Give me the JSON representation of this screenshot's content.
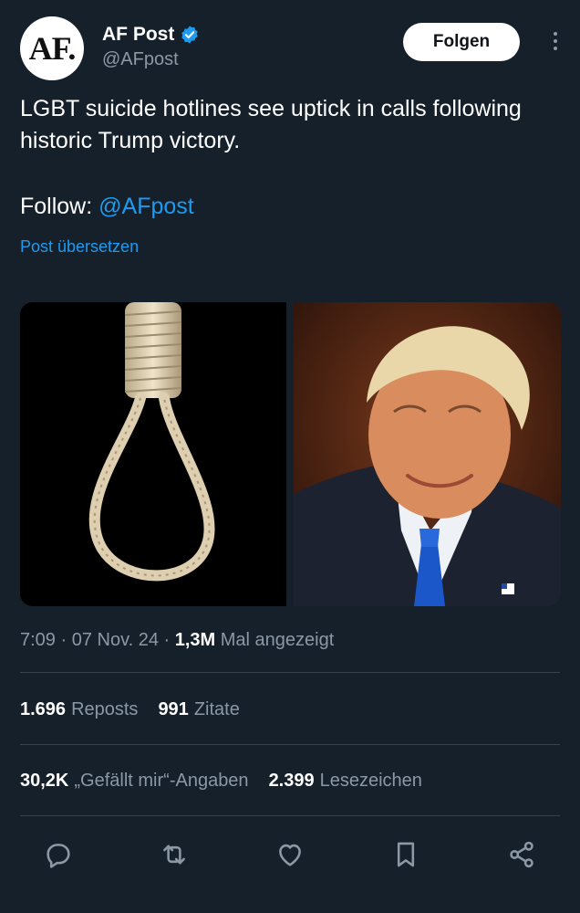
{
  "author": {
    "avatar_text": "AF.",
    "display_name": "AF Post",
    "handle": "@AFpost",
    "verified_icon": "verified-badge-icon",
    "follow_label": "Folgen"
  },
  "tweet": {
    "text": "LGBT suicide hotlines see uptick in calls following historic Trump victory.",
    "follow_prefix": "Follow: ",
    "follow_mention": "@AFpost",
    "translate_label": "Post übersetzen"
  },
  "media": [
    {
      "name": "noose-image"
    },
    {
      "name": "trump-portrait-image"
    }
  ],
  "meta": {
    "time": "7:09",
    "sep1": " · ",
    "date": "07 Nov. 24",
    "sep2": " · ",
    "views": "1,3M",
    "views_label": " Mal angezeigt"
  },
  "stats": {
    "reposts_count": "1.696",
    "reposts_label": "Reposts",
    "quotes_count": "991",
    "quotes_label": "Zitate",
    "likes_count": "30,2K",
    "likes_label": "„Gefällt mir“-Angaben",
    "bookmarks_count": "2.399",
    "bookmarks_label": "Lesezeichen"
  },
  "actions": [
    "reply-icon",
    "repost-icon",
    "like-icon",
    "bookmark-icon",
    "share-icon"
  ],
  "colors": {
    "background": "#15202b",
    "accent": "#1d9bf0",
    "muted": "#8b98a5",
    "divider": "#38444d"
  }
}
